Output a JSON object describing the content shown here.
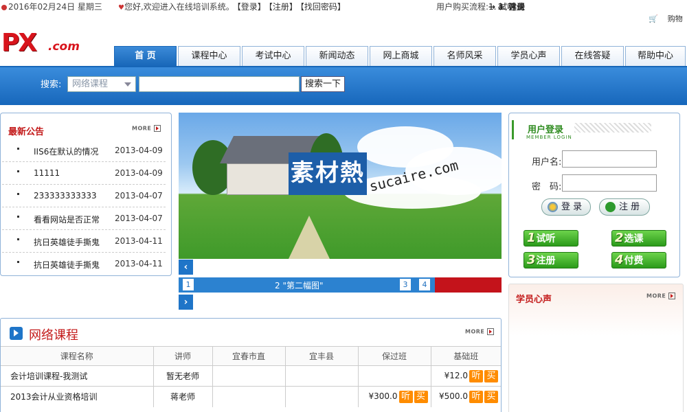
{
  "topbar": {
    "date": "2016年02月24日 星期三",
    "welcome": "您好,欢迎进入在线培训系统。",
    "links": [
      "【登录】",
      "【注册】",
      "【找回密码】"
    ],
    "flow_label": "用户购买流程:",
    "flow_steps": [
      "1. 试听",
      "→ 2. 选课",
      "→ 3. 注册",
      "→ 4. 付费"
    ],
    "cart_text": "购物"
  },
  "logo": {
    "main": "PX",
    "suffix": ".com"
  },
  "nav": [
    "首 页",
    "课程中心",
    "考试中心",
    "新闻动态",
    "网上商城",
    "名师风采",
    "学员心声",
    "在线答疑",
    "帮助中心"
  ],
  "search": {
    "label": "搜索:",
    "select_value": "网络课程",
    "input_value": "",
    "button": "搜索一下"
  },
  "notice": {
    "title": "最新公告",
    "more": "MORE",
    "items": [
      {
        "text": "IIS6在默认的情况",
        "date": "2013-04-09"
      },
      {
        "text": "11111",
        "date": "2013-04-09"
      },
      {
        "text": "233333333333",
        "date": "2013-04-07"
      },
      {
        "text": "看看网站是否正常",
        "date": "2013-04-07"
      },
      {
        "text": "抗日英雄徒手撕鬼",
        "date": "2013-04-11"
      },
      {
        "text": "抗日英雄徒手撕鬼",
        "date": "2013-04-11"
      }
    ]
  },
  "banner": {
    "watermark_main": "素材熱",
    "watermark_url": "sucaire.com"
  },
  "slider": {
    "numbers": [
      "1",
      "3",
      "4"
    ],
    "caption": "2 \"第二幅图\"",
    "prev": "‹",
    "next": "›"
  },
  "login": {
    "title": "用户登录",
    "subtitle": "MEMBER LOGIN",
    "username_label": "用户名:",
    "password_label": "密　码:",
    "username_value": "",
    "password_value": "",
    "login_button": "登 录",
    "register_button": "注 册",
    "steps": [
      {
        "num": "1",
        "text": "试听"
      },
      {
        "num": "2",
        "text": "选课"
      },
      {
        "num": "3",
        "text": "注册"
      },
      {
        "num": "4",
        "text": "付费"
      }
    ]
  },
  "voice": {
    "title": "学员心声",
    "more": "MORE"
  },
  "course": {
    "title": "网络课程",
    "more": "MORE",
    "headers": [
      "课程名称",
      "讲师",
      "宜春市直",
      "宜丰县",
      "保过班",
      "基础班"
    ],
    "rows": [
      {
        "name": "会计培训课程-我测试",
        "teacher": "暂无老师",
        "c1": "",
        "c2": "",
        "c3": "",
        "c4": "¥12.0"
      },
      {
        "name": "2013会计从业资格培训",
        "teacher": "蒋老师",
        "c1": "",
        "c2": "",
        "c3": "¥300.0",
        "c4": "¥500.0"
      }
    ],
    "listen": "听",
    "buy": "买"
  },
  "colors": {
    "brand_blue": "#1f75c8",
    "brand_red": "#c31a1a",
    "green": "#2e8b1f",
    "orange": "#ff8c00"
  }
}
